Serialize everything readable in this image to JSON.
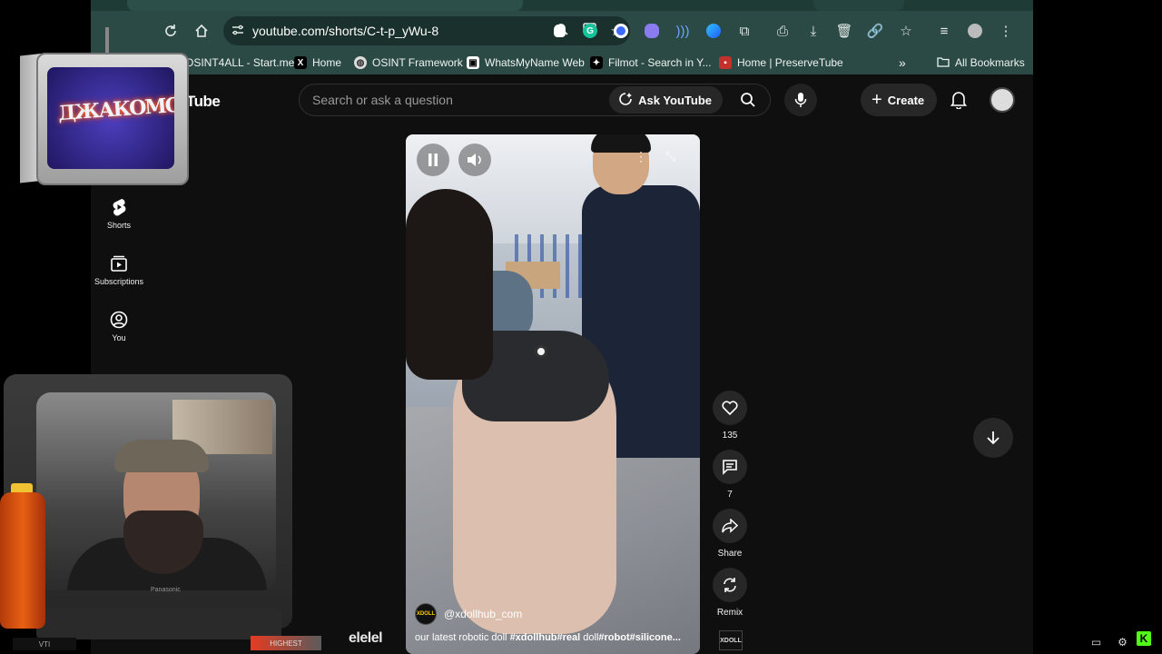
{
  "browser": {
    "url": "youtube.com/shorts/C-t-p_yWu-8",
    "bookmarks": [
      {
        "label": "OSINT4ALL - Start.me",
        "icon": "startme-icon",
        "color": "#2a6df4"
      },
      {
        "label": "Home",
        "icon": "x-icon",
        "color": "#000000"
      },
      {
        "label": "OSINT Framework",
        "icon": "globe-icon",
        "color": "#dddddd"
      },
      {
        "label": "WhatsMyName Web",
        "icon": "whatsmyname-icon",
        "color": "#ffffff"
      },
      {
        "label": "Filmot - Search in Y...",
        "icon": "filmot-icon",
        "color": "#000000"
      },
      {
        "label": "Home | PreserveTube",
        "icon": "preservetube-icon",
        "color": "#c4302b"
      }
    ],
    "all_bookmarks": "All Bookmarks",
    "chevron": "»"
  },
  "youtube": {
    "logo_text": "Tube",
    "search_placeholder": "Search or ask a question",
    "ask_label": "Ask YouTube",
    "create_label": "Create",
    "sidebar": [
      {
        "label": "Shorts",
        "icon": "shorts-icon"
      },
      {
        "label": "Subscriptions",
        "icon": "subscriptions-icon"
      },
      {
        "label": "You",
        "icon": "you-icon"
      }
    ],
    "short": {
      "channel": "@xdollhub_com",
      "caption_plain_1": "our latest robotic doll ",
      "caption_tag_1": "#xdollhub",
      "caption_tag_2": "#real",
      "caption_plain_2": " doll",
      "caption_tag_3": "#robot",
      "caption_tag_4": "#silicone...",
      "channel_avatar_text": "XDOLL"
    },
    "actions": {
      "likes": "135",
      "comments": "7",
      "share": "Share",
      "remix": "Remix"
    }
  },
  "overlay": {
    "tv_graffiti": "ДЖАКОМО",
    "tv_brand": "Panasonic",
    "bottom_text": "elelel",
    "label_left": "VTI",
    "label_right": "HIGHEST"
  }
}
